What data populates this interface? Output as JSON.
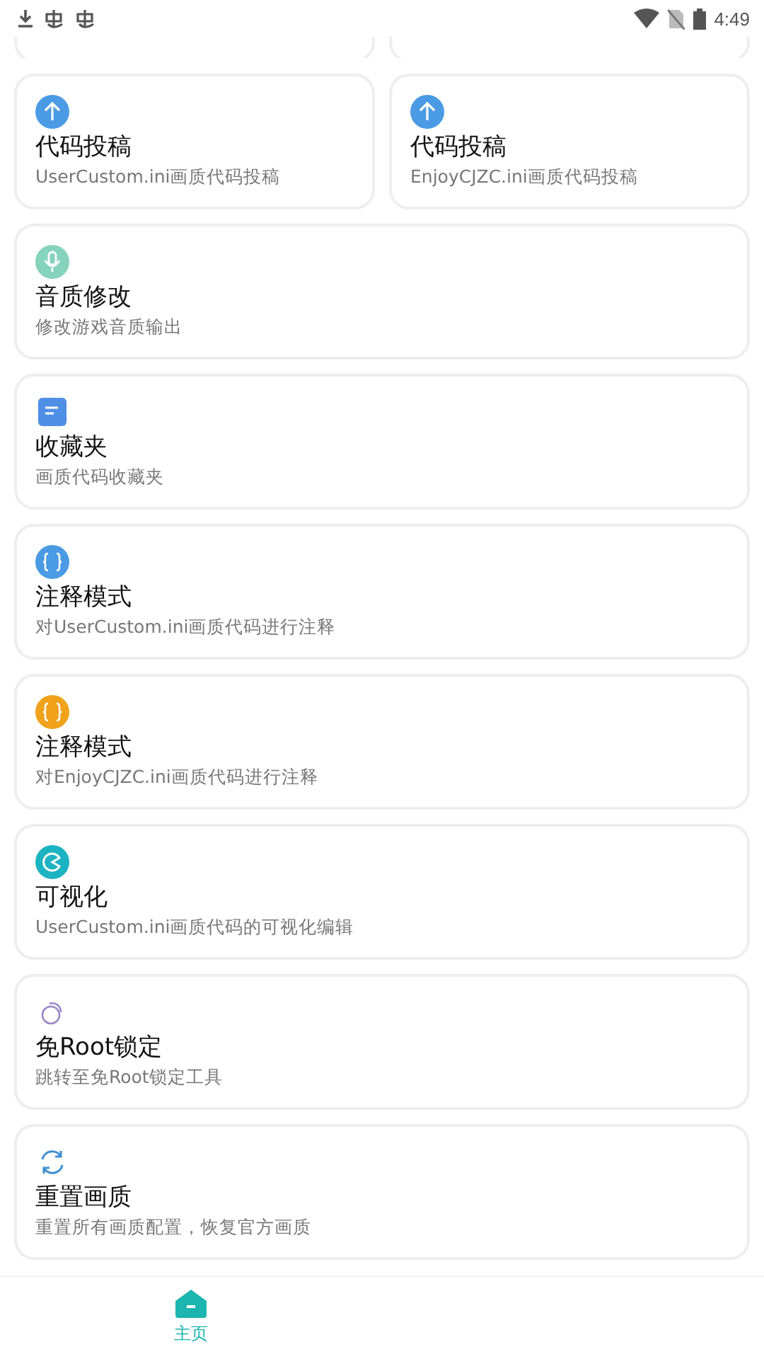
{
  "status_bar": {
    "time": "4:49"
  },
  "grid_cards": [
    {
      "kind": "arrow",
      "color": "#4a9be3",
      "title": "代码投稿",
      "subtitle": "UserCustom.ini画质代码投稿"
    },
    {
      "kind": "arrow",
      "color": "#4a9be3",
      "title": "代码投稿",
      "subtitle": "EnjoyCJZC.ini画质代码投稿"
    }
  ],
  "cards": [
    {
      "kind": "mic",
      "color": "#86d3bb",
      "title": "音质修改",
      "subtitle": "修改游戏音质输出"
    },
    {
      "kind": "note",
      "color": "#4f8fe6",
      "title": "收藏夹",
      "subtitle": "画质代码收藏夹"
    },
    {
      "kind": "braces",
      "color": "#4a9be3",
      "title": "注释模式",
      "subtitle": "对UserCustom.ini画质代码进行注释"
    },
    {
      "kind": "braces",
      "color": "#f0a21c",
      "title": "注释模式",
      "subtitle": "对EnjoyCJZC.ini画质代码进行注释"
    },
    {
      "kind": "pie",
      "color": "#1bb3c2",
      "title": "可视化",
      "subtitle": "UserCustom.ini画质代码的可视化编辑"
    },
    {
      "kind": "rings",
      "color": "#9b86c9",
      "title": "免Root锁定",
      "subtitle": "跳转至免Root锁定工具"
    },
    {
      "kind": "refresh",
      "color": "#3f8fd0",
      "title": "重置画质",
      "subtitle": "重置所有画质配置，恢复官方画质"
    }
  ],
  "bottom_nav": [
    {
      "label": "主页",
      "selected": true
    }
  ]
}
